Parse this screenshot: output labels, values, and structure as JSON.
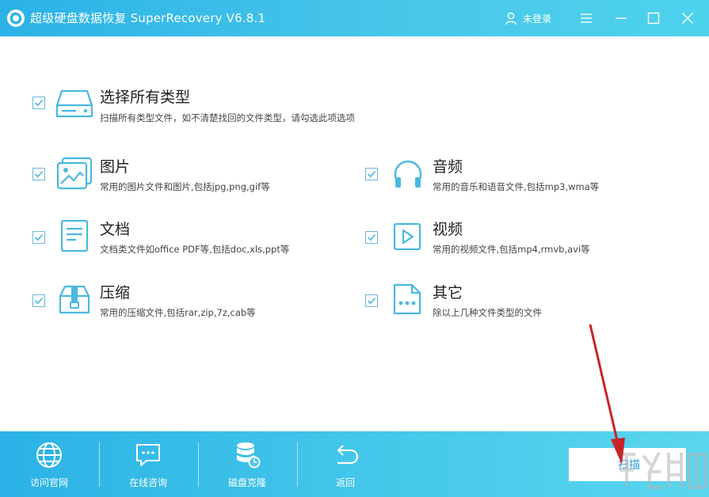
{
  "window": {
    "title": "超级硬盘数据恢复 SuperRecovery V6.8.1",
    "user_label": "未登录"
  },
  "options": {
    "all": {
      "title": "选择所有类型",
      "desc": "扫描所有类型文件，如不清楚找回的文件类型，请勾选此项选项",
      "checked": true,
      "icon": "hard-drive-icon"
    },
    "image": {
      "title": "图片",
      "desc": "常用的图片文件和图片,包括jpg,png,gif等",
      "checked": true,
      "icon": "image-icon"
    },
    "audio": {
      "title": "音频",
      "desc": "常用的音乐和语音文件,包括mp3,wma等",
      "checked": true,
      "icon": "headphones-icon"
    },
    "document": {
      "title": "文档",
      "desc": "文档类文件如office PDF等,包括doc,xls,ppt等",
      "checked": true,
      "icon": "document-icon"
    },
    "video": {
      "title": "视频",
      "desc": "常用的视频文件,包括mp4,rmvb,avi等",
      "checked": true,
      "icon": "video-play-icon"
    },
    "archive": {
      "title": "压缩",
      "desc": "常用的压缩文件,包括rar,zip,7z,cab等",
      "checked": true,
      "icon": "archive-icon"
    },
    "other": {
      "title": "其它",
      "desc": "除以上几种文件类型的文件",
      "checked": true,
      "icon": "more-file-icon"
    }
  },
  "bottom": {
    "website": "访问官网",
    "consult": "在线咨询",
    "clone": "磁盘克隆",
    "back": "返回",
    "scan": "扫描"
  },
  "colors": {
    "accent": "#2bb2e6",
    "icon": "#4ab8e0",
    "arrow": "#c8252a"
  }
}
